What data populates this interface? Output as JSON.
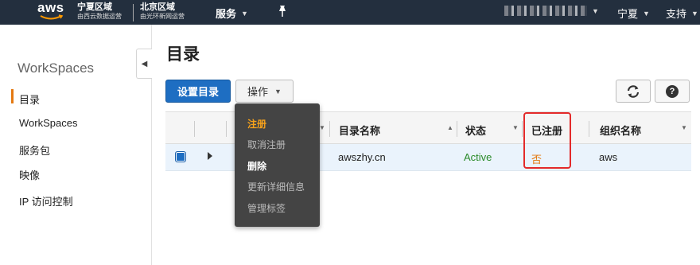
{
  "topnav": {
    "logo_text": "aws",
    "region1_title": "宁夏区域",
    "region1_sub": "由西云数据运营",
    "region2_title": "北京区域",
    "region2_sub": "由光环新网运营",
    "services_label": "服务",
    "region_label": "宁夏",
    "support_label": "支持"
  },
  "sidebar": {
    "title": "WorkSpaces",
    "items": [
      {
        "label": "目录",
        "active": true
      },
      {
        "label": "WorkSpaces"
      },
      {
        "label": "服务包"
      },
      {
        "label": "映像"
      },
      {
        "label": "IP 访问控制"
      }
    ]
  },
  "main": {
    "title": "目录",
    "setup_button": "设置目录",
    "actions_button": "操作"
  },
  "actions_menu": {
    "items": [
      {
        "label": "注册",
        "state": "active"
      },
      {
        "label": "取消注册",
        "state": "disabled"
      },
      {
        "label": "删除",
        "state": "enabled"
      },
      {
        "label": "更新详细信息",
        "state": "disabled"
      },
      {
        "label": "管理标签",
        "state": "disabled"
      }
    ]
  },
  "table": {
    "headers": {
      "name": "目录名称",
      "status": "状态",
      "registered": "已注册",
      "org": "组织名称"
    },
    "rows": [
      {
        "name": "awszhy.cn",
        "status": "Active",
        "registered": "否",
        "org": "aws",
        "selected": true
      }
    ]
  },
  "colors": {
    "nav_bg": "#232f3e",
    "primary": "#1e6ec2",
    "accent": "#e47911",
    "status_active": "#2a8a2a",
    "highlight": "#e32a2a"
  },
  "icons": [
    "aws-logo",
    "pin-icon",
    "refresh-icon",
    "help-icon",
    "chevron-down-icon",
    "chevron-left-icon",
    "expand-icon"
  ]
}
